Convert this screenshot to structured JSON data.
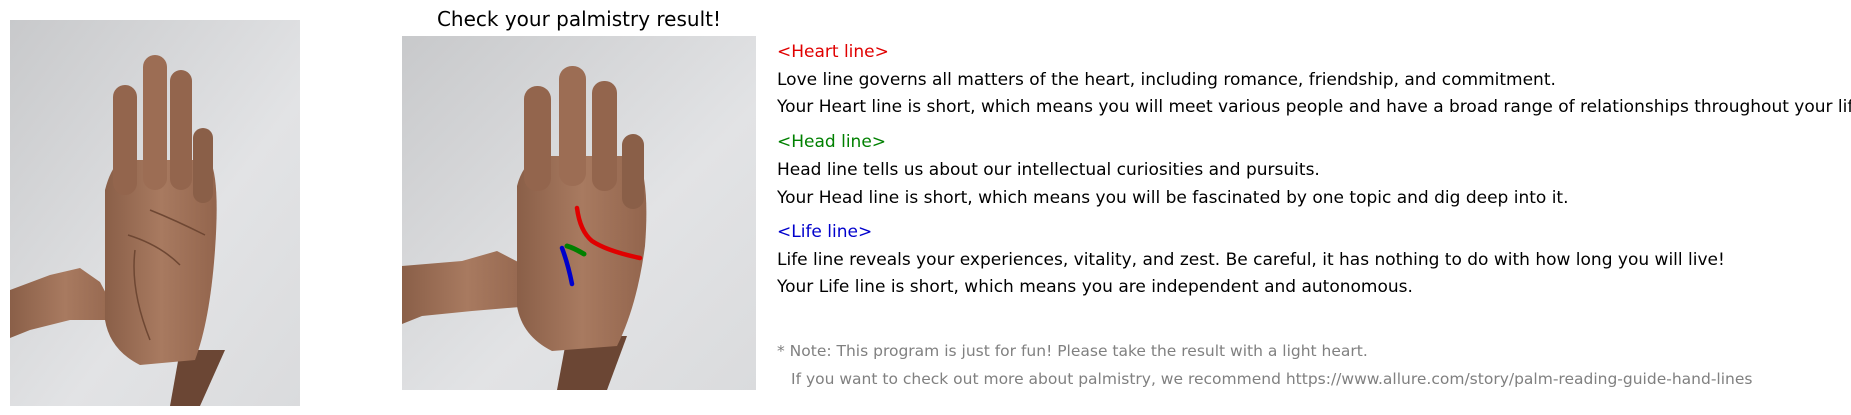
{
  "title": "Check your palmistry result!",
  "heart": {
    "heading": "<Heart line>",
    "line1": "Love line governs all matters of the heart, including romance, friendship, and commitment.",
    "line2": "Your Heart line is short, which means you will meet various people and have a broad range of relationships throughout your life."
  },
  "head": {
    "heading": "<Head line>",
    "line1": "Head line tells us about our intellectual curiosities and pursuits.",
    "line2": "Your Head line is short, which means you will be fascinated by one topic and dig deep into it."
  },
  "life": {
    "heading": "<Life line>",
    "line1": "Life line reveals your experiences, vitality, and zest. Be careful, it has nothing to do with how long you will live!",
    "line2": "Your Life line is short, which means you are independent and autonomous."
  },
  "note": {
    "line1": "* Note: This program is just for fun! Please take the result with a light heart.",
    "line2": "If you want to check out more about palmistry, we recommend https://www.allure.com/story/palm-reading-guide-hand-lines"
  },
  "colors": {
    "heart": "#e00000",
    "head": "#008000",
    "life": "#0000cc"
  }
}
